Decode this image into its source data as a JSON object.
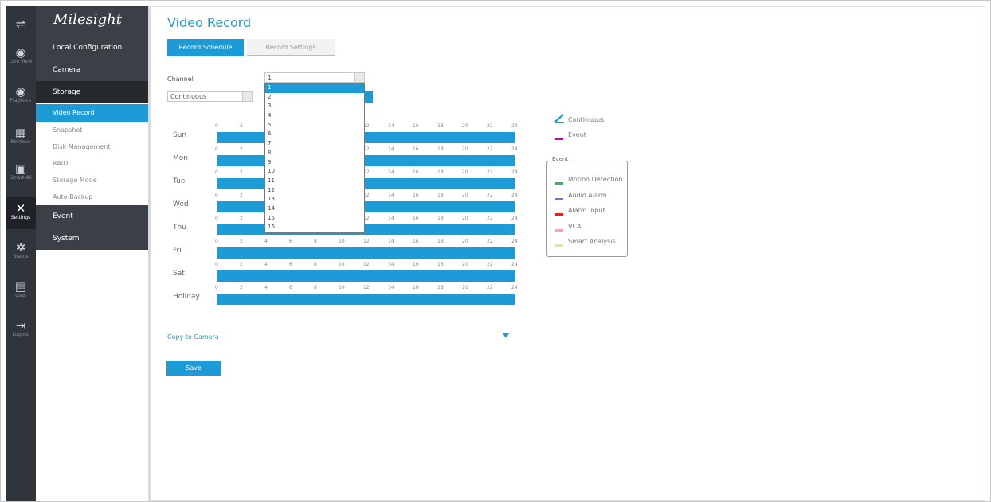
{
  "app": {
    "brand": "Milesight"
  },
  "rail": [
    {
      "icon": "live-view-icon",
      "glyph": "◉",
      "cap": "Live View"
    },
    {
      "icon": "playback-icon",
      "glyph": "◉",
      "cap": "Playback"
    },
    {
      "icon": "retrieve-icon",
      "glyph": "▦",
      "cap": "Retrieve"
    },
    {
      "icon": "smart-analysis-icon",
      "glyph": "▣",
      "cap": "Smart Ali"
    },
    {
      "icon": "settings-icon",
      "glyph": "✕",
      "cap": "Settings"
    },
    {
      "icon": "status-icon",
      "glyph": "✲",
      "cap": "Status"
    },
    {
      "icon": "logs-icon",
      "glyph": "▤",
      "cap": "Logs"
    },
    {
      "icon": "logout-icon",
      "glyph": "⇥",
      "cap": "Logout"
    }
  ],
  "menu": {
    "local_config": "Local Configuration",
    "camera": "Camera",
    "storage": "Storage",
    "storage_items": [
      "Video Record",
      "Snapshot",
      "Disk Management",
      "RAID",
      "Storage Mode",
      "Auto Backup"
    ],
    "event": "Event",
    "system": "System"
  },
  "page": {
    "title": "Video Record",
    "tabs": [
      "Record Schedule",
      "Record Settings"
    ],
    "channel_label": "Channel",
    "channel_value": "1",
    "mode_value": "Continuous",
    "channel_options": [
      "1",
      "2",
      "3",
      "4",
      "5",
      "6",
      "7",
      "8",
      "9",
      "10",
      "11",
      "12",
      "13",
      "14",
      "15",
      "16"
    ],
    "days": [
      "Sun",
      "Mon",
      "Tue",
      "Wed",
      "Thu",
      "Fri",
      "Sat",
      "Holiday"
    ],
    "hour_ticks": [
      "0",
      "2",
      "4",
      "6",
      "8",
      "10",
      "12",
      "14",
      "16",
      "18",
      "20",
      "22",
      "24"
    ],
    "copy_to_camera": "Copy to Camera",
    "save": "Save"
  },
  "legend": {
    "continuous": "Continuous",
    "event": "Event",
    "event_box_title": "Event",
    "event_items": [
      {
        "label": "Motion Detection",
        "color": "#2db94d"
      },
      {
        "label": "Audio Alarm",
        "color": "#6f6fe0"
      },
      {
        "label": "Alarm Input",
        "color": "#e02424"
      },
      {
        "label": "VCA",
        "color": "#f5a3b4"
      },
      {
        "label": "Smart Analysis",
        "color": "#f2e08a"
      }
    ],
    "continuous_color": "#1d9bd7",
    "event_color": "#c800a8"
  },
  "colors": {
    "accent": "#1d9bd7",
    "sidebar": "#3b4046"
  }
}
